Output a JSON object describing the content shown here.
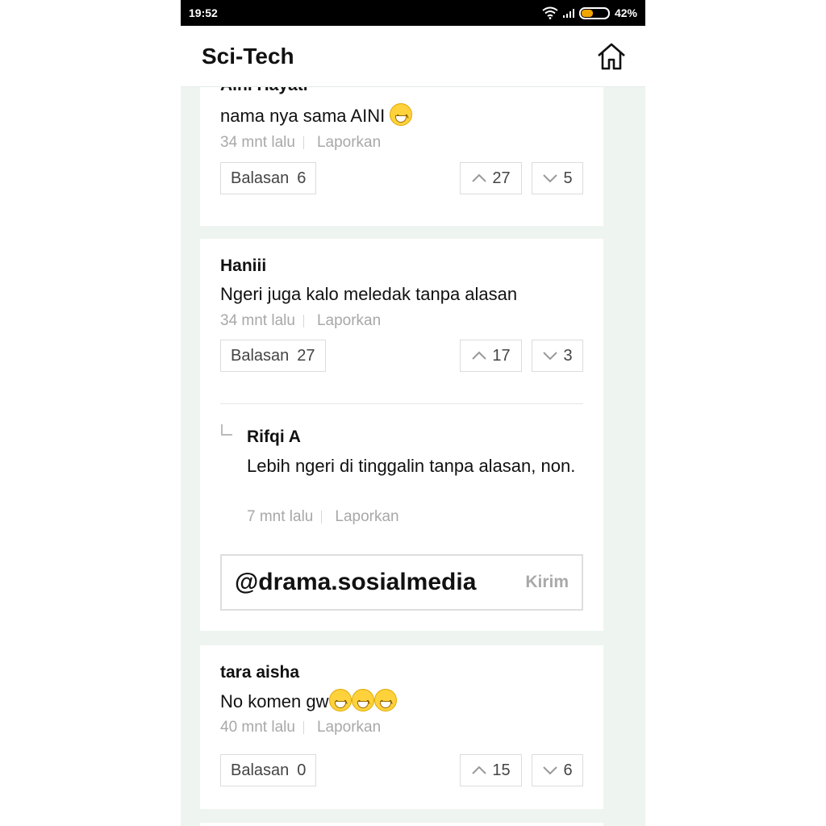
{
  "status_bar": {
    "time": "19:52",
    "battery": "42%",
    "battery_level": 0.42
  },
  "header": {
    "title": "Sci-Tech",
    "home_icon": "home-icon"
  },
  "comments": [
    {
      "author": "Aini Hayati",
      "text": "nama nya sama AINI",
      "emoji_count": 1,
      "time": "34 mnt lalu",
      "report": "Laporkan",
      "reply_label": "Balasan",
      "reply_count": "6",
      "upvotes": "27",
      "downvotes": "5"
    },
    {
      "author": "Haniii",
      "text": "Ngeri juga kalo meledak tanpa alasan",
      "time": "34 mnt lalu",
      "report": "Laporkan",
      "reply_label": "Balasan",
      "reply_count": "27",
      "upvotes": "17",
      "downvotes": "3",
      "reply": {
        "author": "Rifqi A",
        "text": "Lebih ngeri di tinggalin tanpa alasan, non.",
        "time": "7 mnt lalu",
        "report": "Laporkan"
      },
      "input": {
        "watermark": "@drama.sosialmedia",
        "send_label": "Kirim"
      }
    },
    {
      "author": "tara aisha",
      "text": "No komen gw",
      "emoji_count": 3,
      "time": "40 mnt lalu",
      "report": "Laporkan",
      "reply_label": "Balasan",
      "reply_count": "0",
      "upvotes": "15",
      "downvotes": "6"
    }
  ]
}
